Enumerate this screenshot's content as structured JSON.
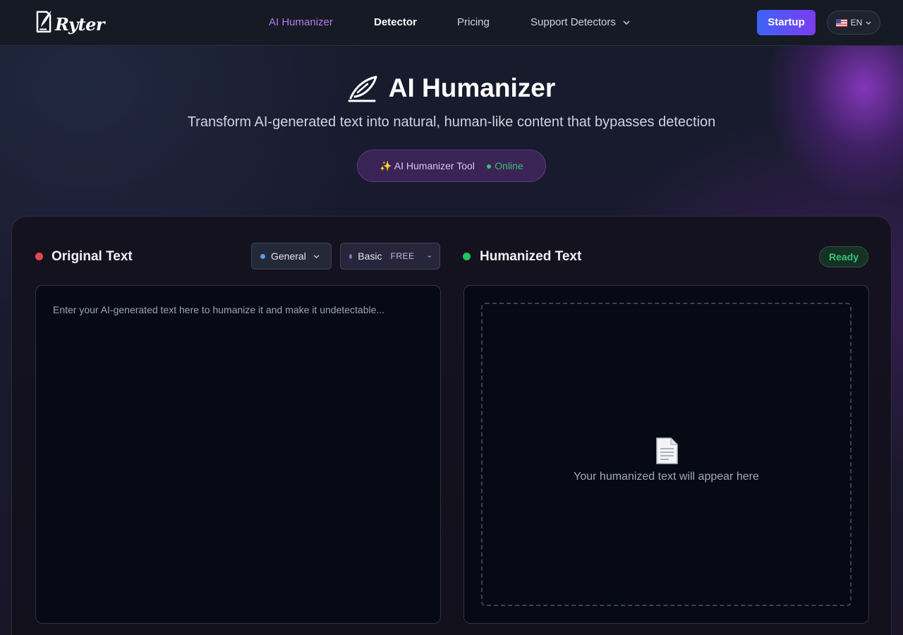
{
  "nav": {
    "brand": "Ryter",
    "links": [
      {
        "label": "AI Humanizer"
      },
      {
        "label": "Detector"
      },
      {
        "label": "Pricing"
      },
      {
        "label": "Support Detectors"
      }
    ],
    "cta_label": "Startup",
    "language": "EN"
  },
  "hero": {
    "title": "AI Humanizer",
    "subtitle": "Transform AI-generated text into natural, human-like content that bypasses detection",
    "badge_label": "✨ AI Humanizer Tool",
    "badge_status": "● Online"
  },
  "editor": {
    "input_heading": "Original Text",
    "mode_select": "General",
    "tier_select": "Basic",
    "tier_badge": "FREE",
    "input_placeholder": "Enter your AI-generated text here to humanize it and make it undetectable...",
    "output_heading": "Humanized Text",
    "status": "Ready",
    "output_placeholder": "Your humanized text will appear here"
  },
  "colors": {
    "accent_purple": "#b57bf0",
    "cta_gradient_start": "#3d63f5",
    "cta_gradient_end": "#7a3df0",
    "input_dot": "#e5484d",
    "output_dot": "#22c55e",
    "status_green": "#39c47a"
  },
  "icons": {
    "logo": "feather-document-logo",
    "hero": "feather-icon",
    "dropdown": "chevron-down-icon",
    "output_empty": "document-icon",
    "language": "us-flag-icon"
  }
}
